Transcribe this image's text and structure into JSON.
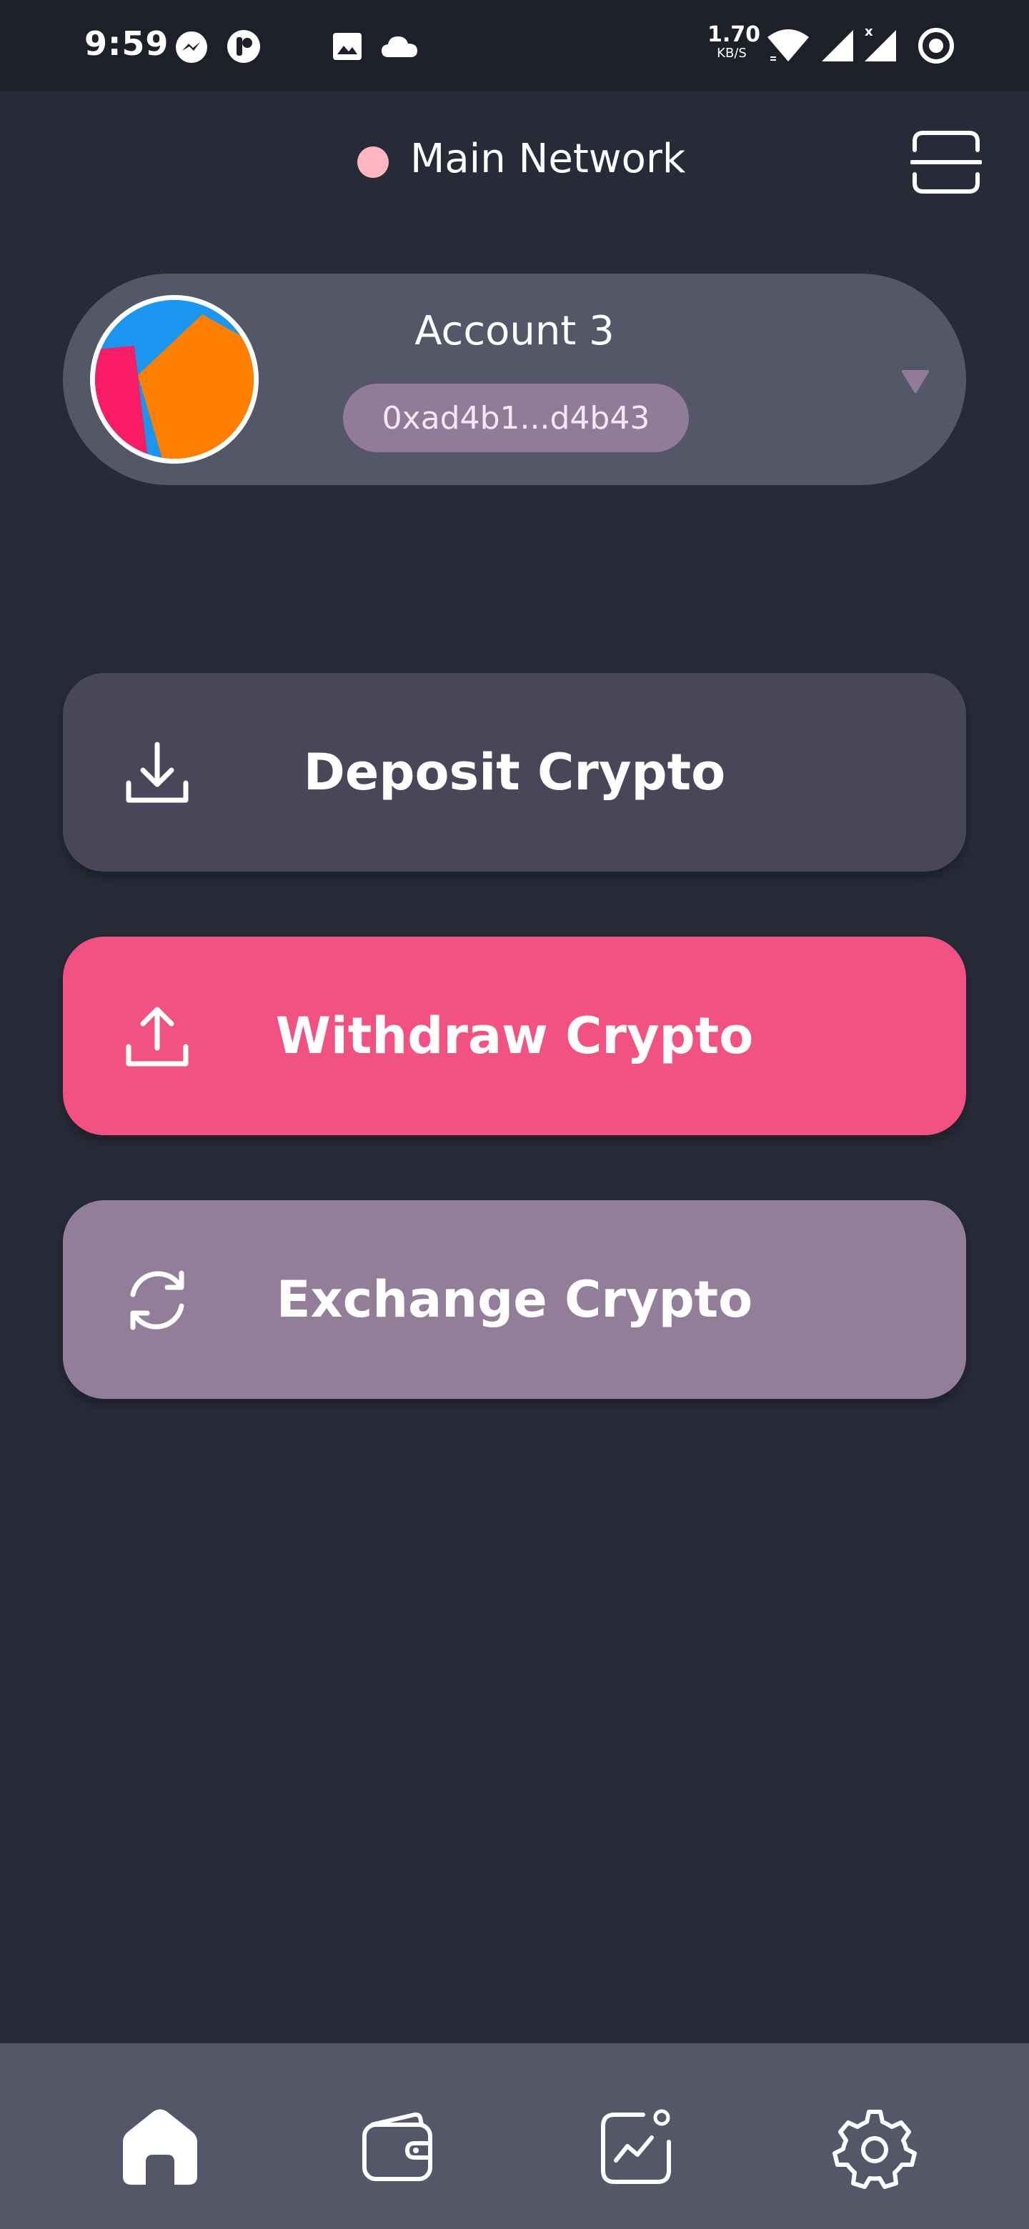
{
  "status_bar": {
    "time": "9:59",
    "net_speed": "1.70",
    "net_unit": "KB/S",
    "icons": [
      "messenger-icon",
      "app-notification-icon",
      "image-icon",
      "cloud-icon",
      "wifi-icon",
      "signal-icon",
      "signal-no-data-icon",
      "record-icon"
    ]
  },
  "header": {
    "network_name": "Main Network",
    "network_dot_color": "#ffb6c1",
    "scan_icon": "scan-icon"
  },
  "account": {
    "name": "Account 3",
    "address": "0xad4b1...d4b43",
    "avatar_colors": [
      "#1a96f0",
      "#ff7f00",
      "#f81c65"
    ],
    "dropdown_icon": "caret-down-icon"
  },
  "actions": [
    {
      "label": "Deposit Crypto",
      "icon": "download-icon",
      "color": "#474759"
    },
    {
      "label": "Withdraw Crypto",
      "icon": "upload-icon",
      "color": "#f15282"
    },
    {
      "label": "Exchange Crypto",
      "icon": "refresh-icon",
      "color": "#927e98"
    }
  ],
  "bottom_nav": {
    "items": [
      {
        "icon": "home-icon",
        "active": true
      },
      {
        "icon": "wallet-icon",
        "active": false
      },
      {
        "icon": "chart-icon",
        "active": false
      },
      {
        "icon": "gear-icon",
        "active": false
      }
    ]
  },
  "colors": {
    "background": "#272a37",
    "status_bar": "#1d1f29",
    "card": "#535767",
    "address_pill": "#927b98"
  }
}
